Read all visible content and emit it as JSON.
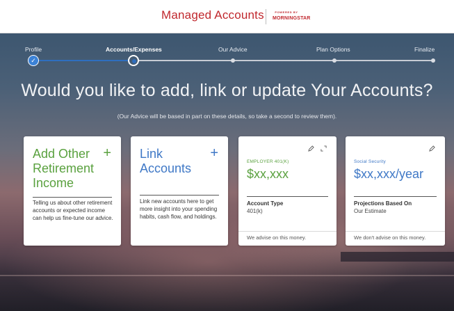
{
  "header": {
    "app_title": "Managed Accounts",
    "partner_powered": "POWERED BY",
    "partner_brand": "MORNINGSTAR"
  },
  "steps": [
    {
      "label": "Profile",
      "state": "done"
    },
    {
      "label": "Accounts/Expenses",
      "state": "current"
    },
    {
      "label": "Our Advice",
      "state": "upcoming"
    },
    {
      "label": "Plan Options",
      "state": "upcoming"
    },
    {
      "label": "Finalize",
      "state": "upcoming"
    }
  ],
  "main": {
    "headline": "Would you like to add, link or update Your Accounts?",
    "subline": "(Our Advice will be based in part on these details, so take a second to review them)."
  },
  "cards": {
    "add_income": {
      "title": "Add Other Retirement Income",
      "icon": "plus-icon",
      "description": "Telling us about other retirement accounts or expected income can help us fine-tune our advice."
    },
    "link_accounts": {
      "title": "Link Accounts",
      "icon": "plus-icon",
      "description": "Link new accounts here to get more insight into your spending habits, cash flow, and holdings."
    },
    "employer_401k": {
      "label": "EMPLOYER 401(K)",
      "value": "$xx,xxx",
      "type_label": "Account Type",
      "type_value": "401(k)",
      "footer": "We advise on this money."
    },
    "social_security": {
      "label": "Social Security",
      "value": "$xx,xxx/year",
      "type_label": "Projections Based On",
      "type_value": "Our Estimate",
      "footer": "We don't advise on this money."
    }
  },
  "colors": {
    "brand_red": "#c0272d",
    "green_accent": "#5aa13f",
    "blue_accent": "#3f78c6",
    "progress_blue": "#2e6fbf"
  }
}
